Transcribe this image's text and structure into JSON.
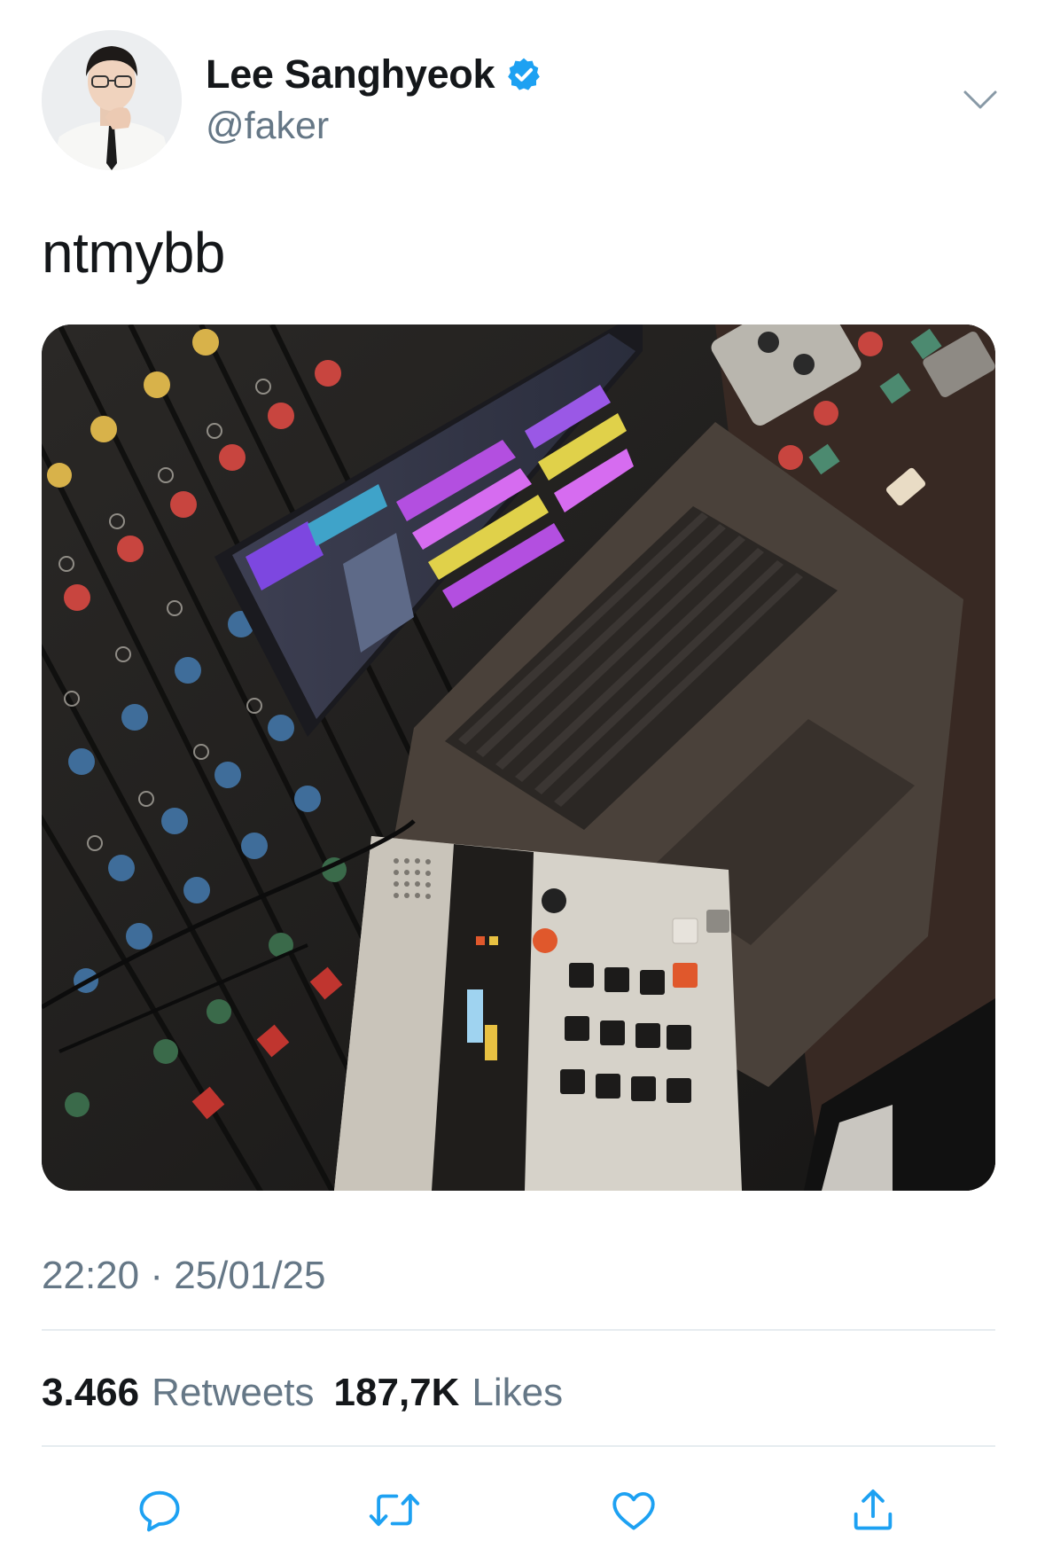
{
  "author": {
    "display_name": "Lee Sanghyeok",
    "handle": "@faker",
    "verified": true
  },
  "tweet": {
    "text": "ntmybb",
    "timestamp": "22:20 · 25/01/25"
  },
  "stats": {
    "retweets_count": "3.466",
    "retweets_label": "Retweets",
    "likes_count": "187,7K",
    "likes_label": "Likes"
  },
  "icons": {
    "verified": "verified-badge-icon",
    "more": "chevron-down-icon",
    "reply": "reply-icon",
    "retweet": "retweet-icon",
    "like": "heart-icon",
    "share": "share-icon"
  },
  "colors": {
    "verified_blue": "#1da1f2",
    "secondary_text": "#657786",
    "primary_text": "#14171a",
    "action_icon": "#1da1f2"
  }
}
